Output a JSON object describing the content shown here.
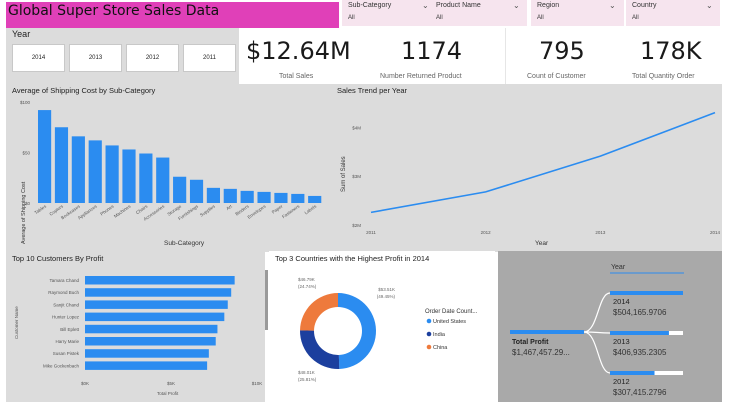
{
  "header": {
    "title": "Global Super Store Sales Data"
  },
  "slicers": [
    {
      "label": "Sub-Category",
      "value": "All"
    },
    {
      "label": "Product Name",
      "value": "All"
    },
    {
      "label": "Region",
      "value": "All"
    },
    {
      "label": "Country",
      "value": "All"
    }
  ],
  "year_slicer": {
    "label": "Year",
    "options": [
      "2014",
      "2013",
      "2012",
      "2011"
    ]
  },
  "kpis": [
    {
      "value": "$12.64M",
      "label": "Total Sales"
    },
    {
      "value": "1174",
      "label": "Number Returned Product"
    },
    {
      "value": "795",
      "label": "Count of Customer"
    },
    {
      "value": "178K",
      "label": "Total Quantity Order"
    }
  ],
  "colors": {
    "accent": "#2b8cf0",
    "title_bar": "#e040b8",
    "slicer_bg": "#f6e4ee",
    "panel_bg": "#dcdcdc",
    "decomp_bg": "#a9a9a9",
    "donut_orange": "#ee7a3c",
    "donut_navy": "#1c3f9e"
  },
  "icons": {
    "slicer_dropdown": "chevron-down-icon"
  },
  "chart_data": [
    {
      "type": "bar",
      "title": "Average of Shipping Cost by Sub-Category",
      "xlabel": "Sub-Category",
      "ylabel": "Average of Shipping Cost",
      "yticks": [
        "$0",
        "$50",
        "$100"
      ],
      "ylim": [
        0,
        100
      ],
      "categories": [
        "Tables",
        "Copiers",
        "Bookcases",
        "Appliances",
        "Phones",
        "Machines",
        "Chairs",
        "Accessories",
        "Storage",
        "Furnishings",
        "Supplies",
        "Art",
        "Binders",
        "Envelopes",
        "Paper",
        "Fasteners",
        "Labels"
      ],
      "values": [
        92,
        75,
        66,
        62,
        57,
        53,
        49,
        45,
        26,
        23,
        15,
        14,
        12,
        11,
        10,
        9,
        7
      ]
    },
    {
      "type": "line",
      "title": "Sales Trend per Year",
      "xlabel": "Year",
      "ylabel": "Sum of Sales",
      "x": [
        "2011",
        "2012",
        "2013",
        "2014"
      ],
      "values": [
        2.26,
        2.68,
        3.41,
        4.3
      ],
      "yticks": [
        "$2M",
        "$3M",
        "$4M"
      ],
      "ylim": [
        1.9,
        4.6
      ]
    },
    {
      "type": "bar",
      "title": "Top 10 Customers By Profit",
      "xlabel": "Total Profit",
      "ylabel": "Customer Name",
      "xticks": [
        "$0K",
        "$5K",
        "$10K"
      ],
      "xlim": [
        0,
        10
      ],
      "categories": [
        "Tamara Chand",
        "Raymond Buch",
        "Sanjit Chand",
        "Hunter Lopez",
        "Bill Eplett",
        "Harry Marie",
        "Susan Pistek",
        "Mike Gockenbach"
      ],
      "values": [
        8.7,
        8.5,
        8.3,
        8.1,
        7.7,
        7.6,
        7.2,
        7.1
      ]
    },
    {
      "type": "pie",
      "title": "Top 3 Countries with the Highest Profit in 2014",
      "legend_title": "Order Date Count...",
      "labels": [
        "United States",
        "India",
        "China"
      ],
      "values": [
        49.45,
        25.81,
        24.74
      ],
      "value_labels": [
        "$53.51K (49.45%)",
        "$48.01K (25.81%)",
        "$46.79K (24.74%)"
      ],
      "colors": [
        "#2b8cf0",
        "#1c3f9e",
        "#ee7a3c"
      ]
    },
    {
      "type": "bar",
      "title": "Year",
      "root_label": "Total Profit",
      "root_value": "$1,467,457.29...",
      "categories": [
        "2014",
        "2013",
        "2012"
      ],
      "value_labels": [
        "$504,165.9706",
        "$406,935.2305",
        "$307,415.2796"
      ],
      "values": [
        504165.97,
        406935.23,
        307415.28
      ]
    }
  ]
}
